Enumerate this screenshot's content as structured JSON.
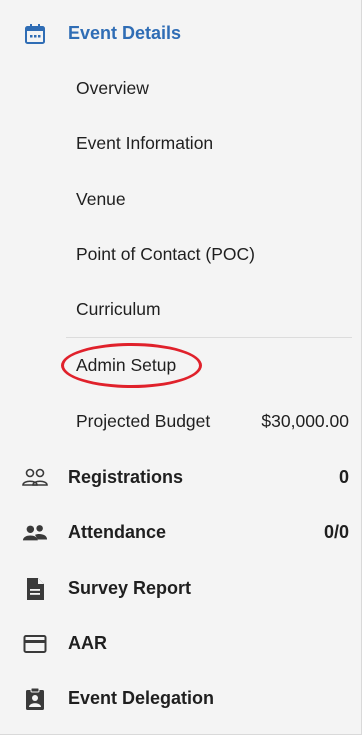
{
  "event_details": {
    "label": "Event Details",
    "items": [
      {
        "label": "Overview"
      },
      {
        "label": "Event Information"
      },
      {
        "label": "Venue"
      },
      {
        "label": "Point of Contact (POC)"
      },
      {
        "label": "Curriculum"
      },
      {
        "label": "Admin Setup"
      },
      {
        "label": "Projected Budget",
        "value": "$30,000.00"
      }
    ]
  },
  "nav": [
    {
      "label": "Registrations",
      "value": "0",
      "icon": "people-outline-icon"
    },
    {
      "label": "Attendance",
      "value": "0/0",
      "icon": "people-filled-icon"
    },
    {
      "label": "Survey Report",
      "icon": "document-icon"
    },
    {
      "label": "AAR",
      "icon": "card-icon"
    },
    {
      "label": "Event Delegation",
      "icon": "badge-icon"
    }
  ],
  "colors": {
    "accent": "#2f6db5",
    "highlight_circle": "#e0212b",
    "icon": "#3a3a3a"
  }
}
